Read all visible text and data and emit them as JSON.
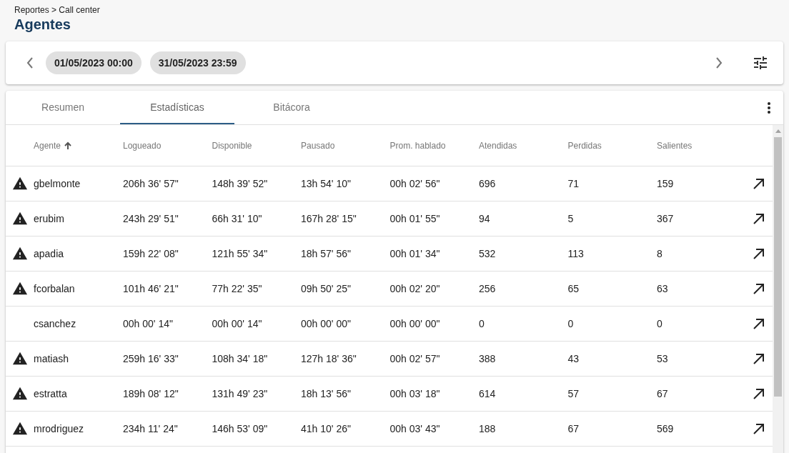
{
  "breadcrumb": "Reportes > Call center",
  "title": "Agentes",
  "date_range": {
    "start": "01/05/2023 00:00",
    "end": "31/05/2023 23:59"
  },
  "tabs": [
    {
      "label": "Resumen",
      "selected": false
    },
    {
      "label": "Estadísticas",
      "selected": true
    },
    {
      "label": "Bitácora",
      "selected": false
    }
  ],
  "table": {
    "columns": [
      {
        "label": "Agente",
        "sorted": true
      },
      {
        "label": "Logueado",
        "sorted": false
      },
      {
        "label": "Disponible",
        "sorted": false
      },
      {
        "label": "Pausado",
        "sorted": false
      },
      {
        "label": "Prom. hablado",
        "sorted": false
      },
      {
        "label": "Atendidas",
        "sorted": false
      },
      {
        "label": "Perdidas",
        "sorted": false
      },
      {
        "label": "Salientes",
        "sorted": false
      }
    ],
    "rows": [
      {
        "warning": true,
        "cells": [
          "gbelmonte",
          "206h 36' 57\"",
          "148h 39' 52\"",
          "13h 54' 10\"",
          "00h 02' 56\"",
          "696",
          "71",
          "159"
        ]
      },
      {
        "warning": true,
        "cells": [
          "erubim",
          "243h 29' 51\"",
          "66h 31' 10\"",
          "167h 28' 15\"",
          "00h 01' 55\"",
          "94",
          "5",
          "367"
        ]
      },
      {
        "warning": true,
        "cells": [
          "apadia",
          "159h 22' 08\"",
          "121h 55' 34\"",
          "18h 57' 56\"",
          "00h 01' 34\"",
          "532",
          "113",
          "8"
        ]
      },
      {
        "warning": true,
        "cells": [
          "fcorbalan",
          "101h 46' 21\"",
          "77h 22' 35\"",
          "09h 50' 25\"",
          "00h 02' 20\"",
          "256",
          "65",
          "63"
        ]
      },
      {
        "warning": false,
        "cells": [
          "csanchez",
          "00h 00' 14\"",
          "00h 00' 14\"",
          "00h 00' 00\"",
          "00h 00' 00\"",
          "0",
          "0",
          "0"
        ]
      },
      {
        "warning": true,
        "cells": [
          "matiash",
          "259h 16' 33\"",
          "108h 34' 18\"",
          "127h 18' 36\"",
          "00h 02' 57\"",
          "388",
          "43",
          "53"
        ]
      },
      {
        "warning": true,
        "cells": [
          "estratta",
          "189h 08' 12\"",
          "131h 49' 23\"",
          "18h 13' 56\"",
          "00h 03' 18\"",
          "614",
          "57",
          "67"
        ]
      },
      {
        "warning": true,
        "cells": [
          "mrodriguez",
          "234h 11' 24\"",
          "146h 53' 09\"",
          "41h 10' 26\"",
          "00h 03' 43\"",
          "188",
          "67",
          "569"
        ]
      }
    ]
  }
}
